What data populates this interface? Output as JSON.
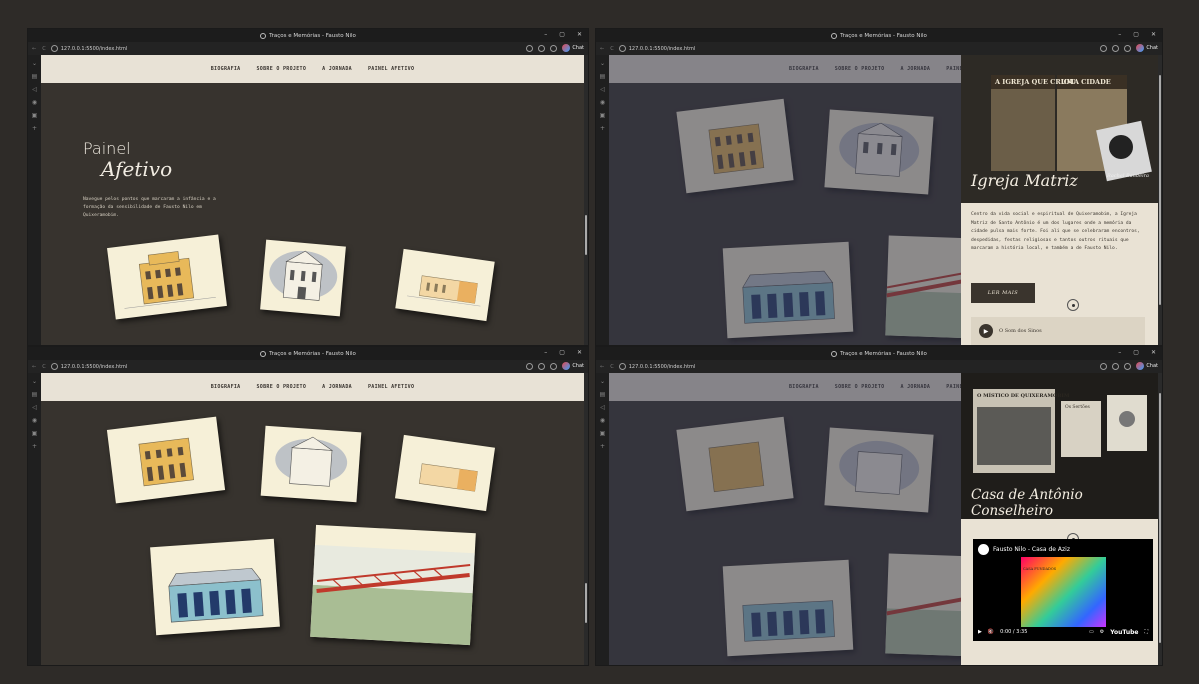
{
  "browser": {
    "window_title": "Traços e Memórias - Fausto Nilo",
    "url": "127.0.0.1:5500/index.html",
    "controls": {
      "minimize": "–",
      "restore": "▢",
      "close": "✕"
    },
    "chat_label": "Chat"
  },
  "nav": {
    "items": [
      "BIOGRAFIA",
      "SOBRE O PROJETO",
      "A JORNADA",
      "PAINEL AFETIVO"
    ]
  },
  "hero": {
    "title_line1": "Painel",
    "title_line2": "Afetivo",
    "intro": "Navegue pelos pontos que marcaram a infância e a formação da sensibilidade de Fausto Nilo em Quixeramobim."
  },
  "panel_igreja": {
    "title": "Igreja Matriz",
    "newspaper_headline1": "A IGREJA QUE CRIOU",
    "newspaper_headline2": "UMA CIDADE",
    "photo_caption": "Rachel Bandeira",
    "description": "Centro da vida social e espiritual de Quixeramobim, a Igreja Matriz de Santo Antônio é um dos lugares onde a memória da cidade pulsa mais forte. Foi ali que se celebraram encontros, despedidas, festas religiosas e tantos outros rituais que marcaram a história local, e também a de Fausto Nilo.",
    "button_label": "LER MAIS",
    "audio_label": "O Som dos Sinos"
  },
  "panel_casa": {
    "title": "Casa de Antônio Conselheiro",
    "newspaper_headline": "O MÍSTICO DE QUIXERAMOBIM",
    "book_label": "Os Sertões",
    "video_title": "Fausto Nilo - Casa de Aziz",
    "video_subtitle": "CASA FUNDADOS",
    "video_time": "0:00 / 3:35",
    "video_brand": "YouTube"
  },
  "colors": {
    "nav_bg": "#e8e2d6",
    "page_bg": "#37332e",
    "card_bg": "#f6f0d8",
    "accent_dark": "#3a342d"
  }
}
